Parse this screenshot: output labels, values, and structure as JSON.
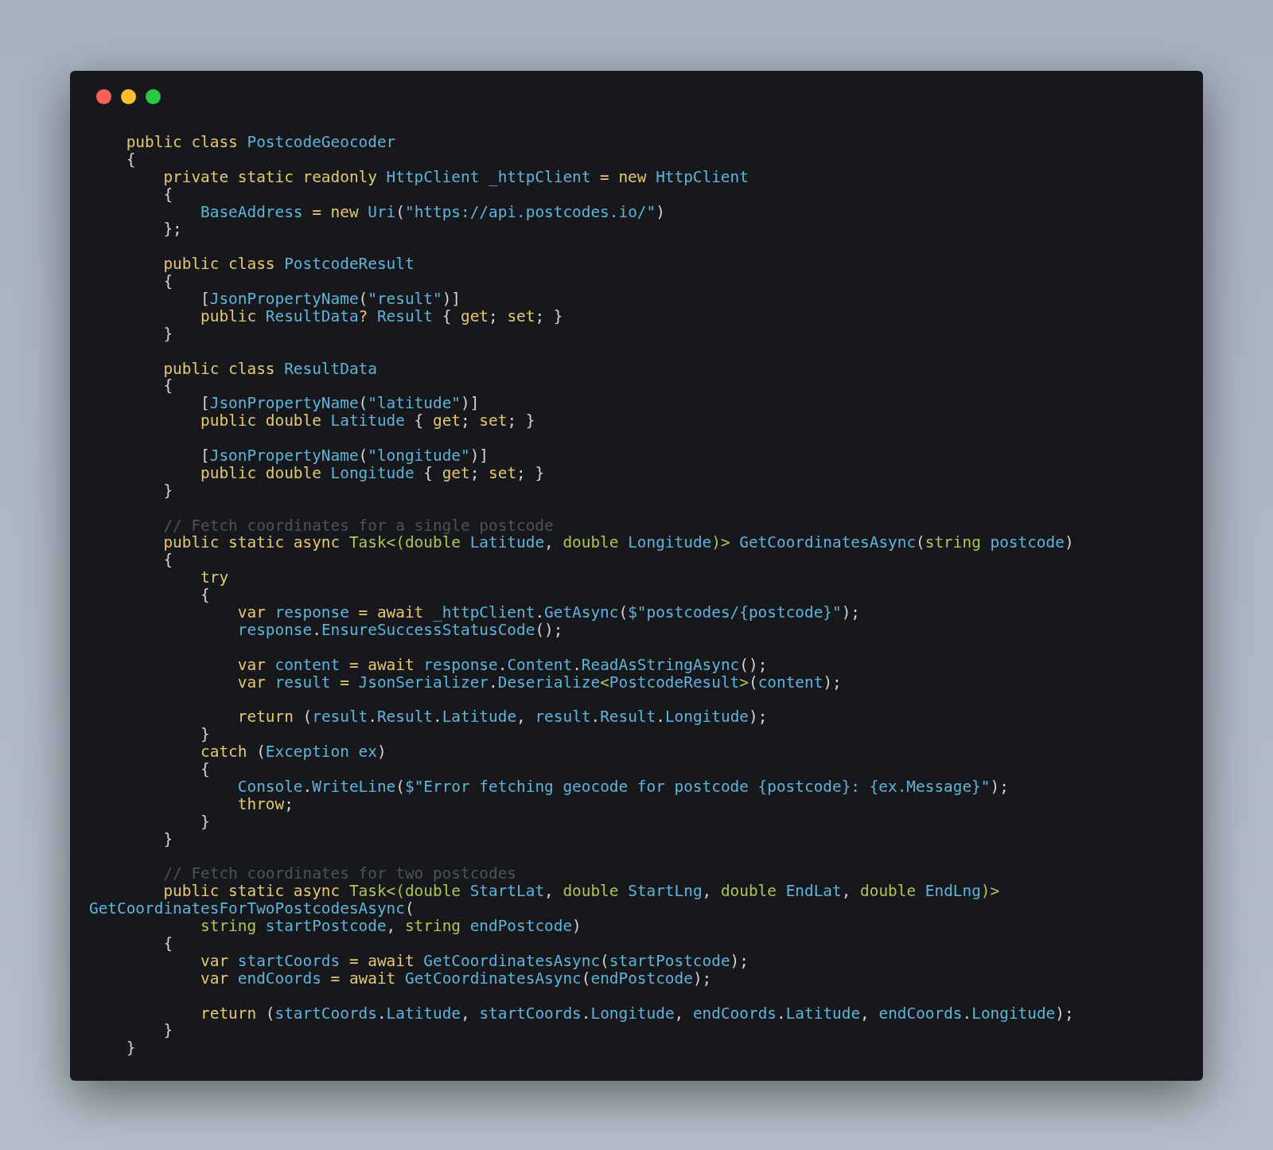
{
  "code": {
    "lines": [
      {
        "kind": "code",
        "tokens": [
          {
            "kind": "keyword",
            "text": "    public class "
          },
          {
            "kind": "name",
            "text": "PostcodeGeocoder"
          }
        ]
      },
      {
        "kind": "code",
        "tokens": [
          {
            "kind": "plain",
            "text": "    {"
          }
        ]
      },
      {
        "kind": "code",
        "tokens": [
          {
            "kind": "keyword",
            "text": "        private static readonly "
          },
          {
            "kind": "name",
            "text": "HttpClient _httpClient "
          },
          {
            "kind": "keyword",
            "text": "= new "
          },
          {
            "kind": "name",
            "text": "HttpClient"
          }
        ]
      },
      {
        "kind": "code",
        "tokens": [
          {
            "kind": "plain",
            "text": "        {"
          }
        ]
      },
      {
        "kind": "code",
        "tokens": [
          {
            "kind": "name",
            "text": "            BaseAddress "
          },
          {
            "kind": "keyword",
            "text": "= new "
          },
          {
            "kind": "name",
            "text": "Uri"
          },
          {
            "kind": "plain",
            "text": "("
          },
          {
            "kind": "name",
            "text": "\"https://api.postcodes.io/\""
          },
          {
            "kind": "plain",
            "text": ")"
          }
        ]
      },
      {
        "kind": "code",
        "tokens": [
          {
            "kind": "plain",
            "text": "        };"
          }
        ]
      },
      {
        "kind": "blank"
      },
      {
        "kind": "code",
        "tokens": [
          {
            "kind": "keyword",
            "text": "        public class "
          },
          {
            "kind": "name",
            "text": "PostcodeResult"
          }
        ]
      },
      {
        "kind": "code",
        "tokens": [
          {
            "kind": "plain",
            "text": "        {"
          }
        ]
      },
      {
        "kind": "code",
        "tokens": [
          {
            "kind": "plain",
            "text": "            ["
          },
          {
            "kind": "name",
            "text": "JsonPropertyName"
          },
          {
            "kind": "plain",
            "text": "("
          },
          {
            "kind": "name",
            "text": "\"result\""
          },
          {
            "kind": "plain",
            "text": ")]"
          }
        ]
      },
      {
        "kind": "code",
        "tokens": [
          {
            "kind": "keyword",
            "text": "            public "
          },
          {
            "kind": "name",
            "text": "ResultData"
          },
          {
            "kind": "keyword",
            "text": "? "
          },
          {
            "kind": "name",
            "text": "Result "
          },
          {
            "kind": "plain",
            "text": "{ "
          },
          {
            "kind": "keyword",
            "text": "get"
          },
          {
            "kind": "plain",
            "text": "; "
          },
          {
            "kind": "keyword",
            "text": "set"
          },
          {
            "kind": "plain",
            "text": "; }"
          }
        ]
      },
      {
        "kind": "code",
        "tokens": [
          {
            "kind": "plain",
            "text": "        }"
          }
        ]
      },
      {
        "kind": "blank"
      },
      {
        "kind": "code",
        "tokens": [
          {
            "kind": "keyword",
            "text": "        public class "
          },
          {
            "kind": "name",
            "text": "ResultData"
          }
        ]
      },
      {
        "kind": "code",
        "tokens": [
          {
            "kind": "plain",
            "text": "        {"
          }
        ]
      },
      {
        "kind": "code",
        "tokens": [
          {
            "kind": "plain",
            "text": "            ["
          },
          {
            "kind": "name",
            "text": "JsonPropertyName"
          },
          {
            "kind": "plain",
            "text": "("
          },
          {
            "kind": "name",
            "text": "\"latitude\""
          },
          {
            "kind": "plain",
            "text": ")]"
          }
        ]
      },
      {
        "kind": "code",
        "tokens": [
          {
            "kind": "keyword",
            "text": "            public double "
          },
          {
            "kind": "name",
            "text": "Latitude "
          },
          {
            "kind": "plain",
            "text": "{ "
          },
          {
            "kind": "keyword",
            "text": "get"
          },
          {
            "kind": "plain",
            "text": "; "
          },
          {
            "kind": "keyword",
            "text": "set"
          },
          {
            "kind": "plain",
            "text": "; }"
          }
        ]
      },
      {
        "kind": "blank"
      },
      {
        "kind": "code",
        "tokens": [
          {
            "kind": "plain",
            "text": "            ["
          },
          {
            "kind": "name",
            "text": "JsonPropertyName"
          },
          {
            "kind": "plain",
            "text": "("
          },
          {
            "kind": "name",
            "text": "\"longitude\""
          },
          {
            "kind": "plain",
            "text": ")]"
          }
        ]
      },
      {
        "kind": "code",
        "tokens": [
          {
            "kind": "keyword",
            "text": "            public double "
          },
          {
            "kind": "name",
            "text": "Longitude "
          },
          {
            "kind": "plain",
            "text": "{ "
          },
          {
            "kind": "keyword",
            "text": "get"
          },
          {
            "kind": "plain",
            "text": "; "
          },
          {
            "kind": "keyword",
            "text": "set"
          },
          {
            "kind": "plain",
            "text": "; }"
          }
        ]
      },
      {
        "kind": "code",
        "tokens": [
          {
            "kind": "plain",
            "text": "        }"
          }
        ]
      },
      {
        "kind": "blank"
      },
      {
        "kind": "code",
        "tokens": [
          {
            "kind": "comment",
            "text": "        // Fetch coordinates for a single postcode"
          }
        ]
      },
      {
        "kind": "code",
        "tokens": [
          {
            "kind": "keyword",
            "text": "        public static async "
          },
          {
            "kind": "type",
            "text": "Task<(double "
          },
          {
            "kind": "name",
            "text": "Latitude"
          },
          {
            "kind": "plain",
            "text": ", "
          },
          {
            "kind": "type",
            "text": "double "
          },
          {
            "kind": "name",
            "text": "Longitude"
          },
          {
            "kind": "type",
            "text": ")> "
          },
          {
            "kind": "name",
            "text": "GetCoordinatesAsync"
          },
          {
            "kind": "plain",
            "text": "("
          },
          {
            "kind": "type",
            "text": "string "
          },
          {
            "kind": "name",
            "text": "postcode"
          },
          {
            "kind": "plain",
            "text": ")"
          }
        ]
      },
      {
        "kind": "code",
        "tokens": [
          {
            "kind": "plain",
            "text": "        {"
          }
        ]
      },
      {
        "kind": "code",
        "tokens": [
          {
            "kind": "keyword",
            "text": "            try"
          }
        ]
      },
      {
        "kind": "code",
        "tokens": [
          {
            "kind": "plain",
            "text": "            {"
          }
        ]
      },
      {
        "kind": "code",
        "tokens": [
          {
            "kind": "keyword",
            "text": "                var "
          },
          {
            "kind": "name",
            "text": "response "
          },
          {
            "kind": "keyword",
            "text": "= await "
          },
          {
            "kind": "name",
            "text": "_httpClient"
          },
          {
            "kind": "plain",
            "text": "."
          },
          {
            "kind": "name",
            "text": "GetAsync"
          },
          {
            "kind": "plain",
            "text": "("
          },
          {
            "kind": "name",
            "text": "$\"postcodes/{postcode}\""
          },
          {
            "kind": "plain",
            "text": ");"
          }
        ]
      },
      {
        "kind": "code",
        "tokens": [
          {
            "kind": "name",
            "text": "                response"
          },
          {
            "kind": "plain",
            "text": "."
          },
          {
            "kind": "name",
            "text": "EnsureSuccessStatusCode"
          },
          {
            "kind": "plain",
            "text": "();"
          }
        ]
      },
      {
        "kind": "blank"
      },
      {
        "kind": "code",
        "tokens": [
          {
            "kind": "keyword",
            "text": "                var "
          },
          {
            "kind": "name",
            "text": "content "
          },
          {
            "kind": "keyword",
            "text": "= await "
          },
          {
            "kind": "name",
            "text": "response"
          },
          {
            "kind": "plain",
            "text": "."
          },
          {
            "kind": "name",
            "text": "Content"
          },
          {
            "kind": "plain",
            "text": "."
          },
          {
            "kind": "name",
            "text": "ReadAsStringAsync"
          },
          {
            "kind": "plain",
            "text": "();"
          }
        ]
      },
      {
        "kind": "code",
        "tokens": [
          {
            "kind": "keyword",
            "text": "                var "
          },
          {
            "kind": "name",
            "text": "result "
          },
          {
            "kind": "keyword",
            "text": "= "
          },
          {
            "kind": "name",
            "text": "JsonSerializer"
          },
          {
            "kind": "plain",
            "text": "."
          },
          {
            "kind": "name",
            "text": "Deserialize"
          },
          {
            "kind": "type",
            "text": "<"
          },
          {
            "kind": "name",
            "text": "PostcodeResult"
          },
          {
            "kind": "type",
            "text": ">"
          },
          {
            "kind": "plain",
            "text": "("
          },
          {
            "kind": "name",
            "text": "content"
          },
          {
            "kind": "plain",
            "text": ");"
          }
        ]
      },
      {
        "kind": "blank"
      },
      {
        "kind": "code",
        "tokens": [
          {
            "kind": "keyword",
            "text": "                return "
          },
          {
            "kind": "plain",
            "text": "("
          },
          {
            "kind": "name",
            "text": "result"
          },
          {
            "kind": "plain",
            "text": "."
          },
          {
            "kind": "name",
            "text": "Result"
          },
          {
            "kind": "plain",
            "text": "."
          },
          {
            "kind": "name",
            "text": "Latitude"
          },
          {
            "kind": "plain",
            "text": ", "
          },
          {
            "kind": "name",
            "text": "result"
          },
          {
            "kind": "plain",
            "text": "."
          },
          {
            "kind": "name",
            "text": "Result"
          },
          {
            "kind": "plain",
            "text": "."
          },
          {
            "kind": "name",
            "text": "Longitude"
          },
          {
            "kind": "plain",
            "text": ");"
          }
        ]
      },
      {
        "kind": "code",
        "tokens": [
          {
            "kind": "plain",
            "text": "            }"
          }
        ]
      },
      {
        "kind": "code",
        "tokens": [
          {
            "kind": "keyword",
            "text": "            catch "
          },
          {
            "kind": "plain",
            "text": "("
          },
          {
            "kind": "name",
            "text": "Exception ex"
          },
          {
            "kind": "plain",
            "text": ")"
          }
        ]
      },
      {
        "kind": "code",
        "tokens": [
          {
            "kind": "plain",
            "text": "            {"
          }
        ]
      },
      {
        "kind": "code",
        "tokens": [
          {
            "kind": "name",
            "text": "                Console"
          },
          {
            "kind": "plain",
            "text": "."
          },
          {
            "kind": "name",
            "text": "WriteLine"
          },
          {
            "kind": "plain",
            "text": "("
          },
          {
            "kind": "name",
            "text": "$\"Error fetching geocode for postcode {postcode}: {ex.Message}\""
          },
          {
            "kind": "plain",
            "text": ");"
          }
        ]
      },
      {
        "kind": "code",
        "tokens": [
          {
            "kind": "keyword",
            "text": "                throw"
          },
          {
            "kind": "plain",
            "text": ";"
          }
        ]
      },
      {
        "kind": "code",
        "tokens": [
          {
            "kind": "plain",
            "text": "            }"
          }
        ]
      },
      {
        "kind": "code",
        "tokens": [
          {
            "kind": "plain",
            "text": "        }"
          }
        ]
      },
      {
        "kind": "blank"
      },
      {
        "kind": "code",
        "tokens": [
          {
            "kind": "comment",
            "text": "        // Fetch coordinates for two postcodes"
          }
        ]
      },
      {
        "kind": "code",
        "tokens": [
          {
            "kind": "keyword",
            "text": "        public static async "
          },
          {
            "kind": "type",
            "text": "Task<(double "
          },
          {
            "kind": "name",
            "text": "StartLat"
          },
          {
            "kind": "plain",
            "text": ", "
          },
          {
            "kind": "type",
            "text": "double "
          },
          {
            "kind": "name",
            "text": "StartLng"
          },
          {
            "kind": "plain",
            "text": ", "
          },
          {
            "kind": "type",
            "text": "double "
          },
          {
            "kind": "name",
            "text": "EndLat"
          },
          {
            "kind": "plain",
            "text": ", "
          },
          {
            "kind": "type",
            "text": "double "
          },
          {
            "kind": "name",
            "text": "EndLng"
          },
          {
            "kind": "type",
            "text": ")>"
          }
        ]
      },
      {
        "kind": "code",
        "tokens": [
          {
            "kind": "name",
            "text": "GetCoordinatesForTwoPostcodesAsync"
          },
          {
            "kind": "plain",
            "text": "("
          }
        ]
      },
      {
        "kind": "code",
        "tokens": [
          {
            "kind": "type",
            "text": "            string "
          },
          {
            "kind": "name",
            "text": "startPostcode"
          },
          {
            "kind": "plain",
            "text": ", "
          },
          {
            "kind": "type",
            "text": "string "
          },
          {
            "kind": "name",
            "text": "endPostcode"
          },
          {
            "kind": "plain",
            "text": ")"
          }
        ]
      },
      {
        "kind": "code",
        "tokens": [
          {
            "kind": "plain",
            "text": "        {"
          }
        ]
      },
      {
        "kind": "code",
        "tokens": [
          {
            "kind": "keyword",
            "text": "            var "
          },
          {
            "kind": "name",
            "text": "startCoords "
          },
          {
            "kind": "keyword",
            "text": "= await "
          },
          {
            "kind": "name",
            "text": "GetCoordinatesAsync"
          },
          {
            "kind": "plain",
            "text": "("
          },
          {
            "kind": "name",
            "text": "startPostcode"
          },
          {
            "kind": "plain",
            "text": ");"
          }
        ]
      },
      {
        "kind": "code",
        "tokens": [
          {
            "kind": "keyword",
            "text": "            var "
          },
          {
            "kind": "name",
            "text": "endCoords "
          },
          {
            "kind": "keyword",
            "text": "= await "
          },
          {
            "kind": "name",
            "text": "GetCoordinatesAsync"
          },
          {
            "kind": "plain",
            "text": "("
          },
          {
            "kind": "name",
            "text": "endPostcode"
          },
          {
            "kind": "plain",
            "text": ");"
          }
        ]
      },
      {
        "kind": "blank"
      },
      {
        "kind": "code",
        "tokens": [
          {
            "kind": "keyword",
            "text": "            return "
          },
          {
            "kind": "plain",
            "text": "("
          },
          {
            "kind": "name",
            "text": "startCoords"
          },
          {
            "kind": "plain",
            "text": "."
          },
          {
            "kind": "name",
            "text": "Latitude"
          },
          {
            "kind": "plain",
            "text": ", "
          },
          {
            "kind": "name",
            "text": "startCoords"
          },
          {
            "kind": "plain",
            "text": "."
          },
          {
            "kind": "name",
            "text": "Longitude"
          },
          {
            "kind": "plain",
            "text": ", "
          },
          {
            "kind": "name",
            "text": "endCoords"
          },
          {
            "kind": "plain",
            "text": "."
          },
          {
            "kind": "name",
            "text": "Latitude"
          },
          {
            "kind": "plain",
            "text": ", "
          },
          {
            "kind": "name",
            "text": "endCoords"
          },
          {
            "kind": "plain",
            "text": "."
          },
          {
            "kind": "name",
            "text": "Longitude"
          },
          {
            "kind": "plain",
            "text": ");"
          }
        ]
      },
      {
        "kind": "code",
        "tokens": [
          {
            "kind": "plain",
            "text": "        }"
          }
        ]
      },
      {
        "kind": "code",
        "tokens": [
          {
            "kind": "plain",
            "text": "    }"
          }
        ]
      }
    ]
  }
}
